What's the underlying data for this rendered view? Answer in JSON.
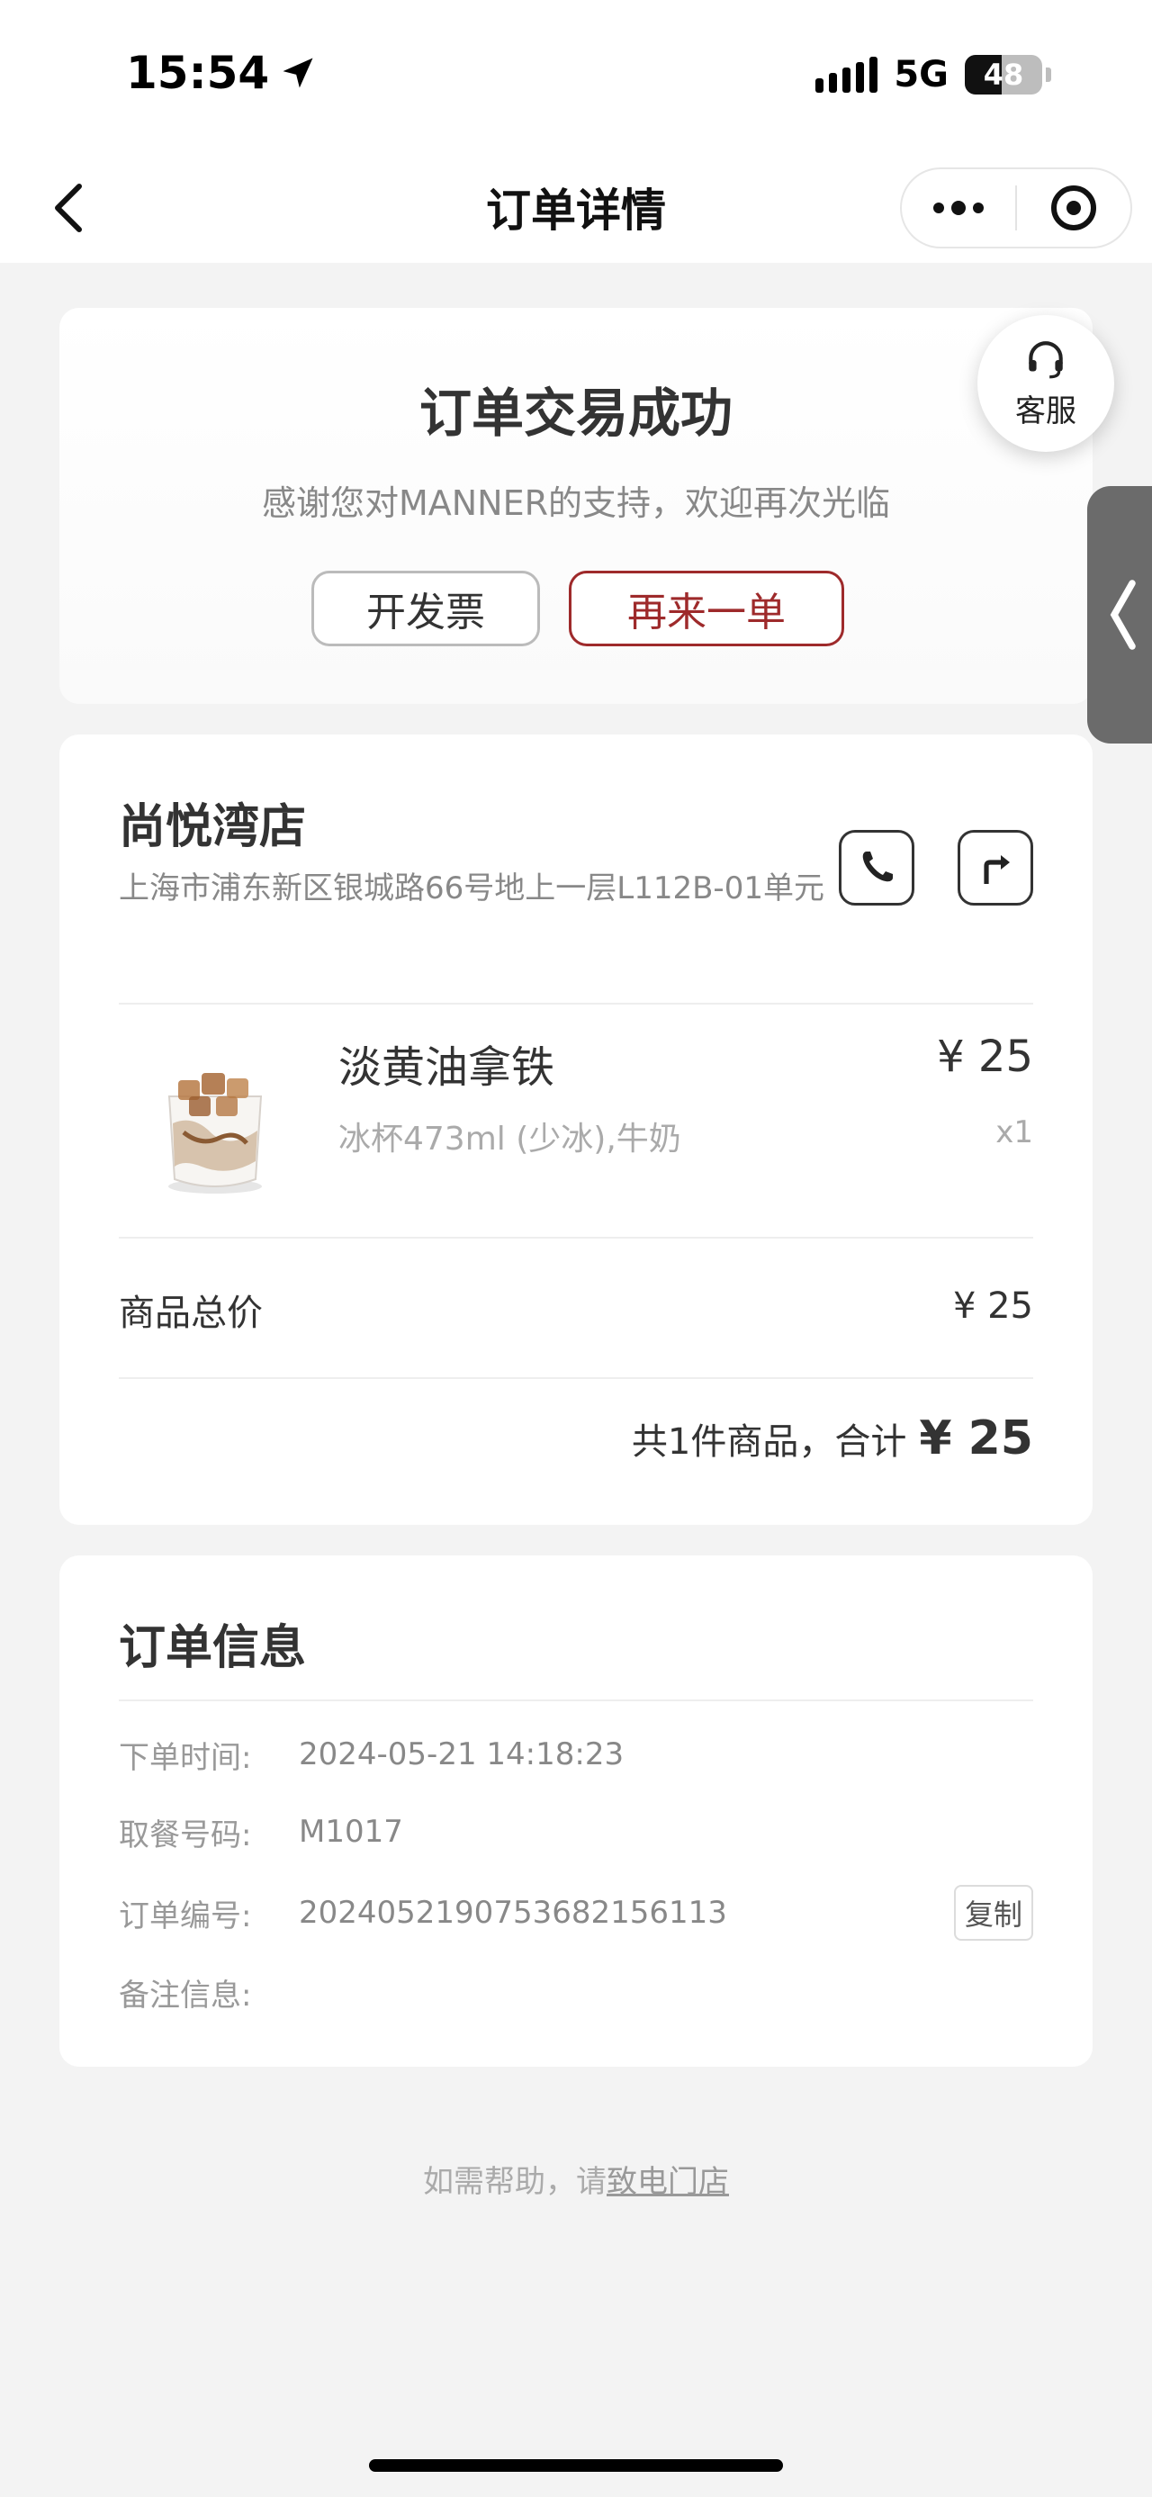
{
  "status_bar": {
    "time": "15:54",
    "network": "5G",
    "battery": "48"
  },
  "nav": {
    "title": "订单详情"
  },
  "status_card": {
    "title": "订单交易成功",
    "subtitle": "感谢您对MANNER的支持，欢迎再次光临",
    "invoice_label": "开发票",
    "reorder_label": "再来一单"
  },
  "service": {
    "label": "客服"
  },
  "store": {
    "name": "尚悦湾店",
    "address": "上海市浦东新区银城路66号地上一层L112B-01单元"
  },
  "product": {
    "name": "淡黄油拿铁",
    "spec": "冰杯473ml (少冰),牛奶",
    "price": "¥ 25",
    "qty": "x1"
  },
  "summary": {
    "subtotal_label": "商品总价",
    "subtotal_value": "¥ 25",
    "total_text": "共1件商品，合计",
    "total_value": "¥ 25"
  },
  "order_info": {
    "title": "订单信息",
    "rows": [
      {
        "label": "下单时间:",
        "value": "2024-05-21 14:18:23"
      },
      {
        "label": "取餐号码:",
        "value": "M1017"
      },
      {
        "label": "订单编号:",
        "value": "2024052190753682156113"
      },
      {
        "label": "备注信息:",
        "value": ""
      }
    ],
    "copy_label": "复制"
  },
  "footer": {
    "help_prefix": "如需帮助，请",
    "help_link": "致电门店"
  },
  "colors": {
    "accent": "#9e2a2b",
    "background": "#f3f3f3",
    "side_tab": "#6b6b6b"
  }
}
